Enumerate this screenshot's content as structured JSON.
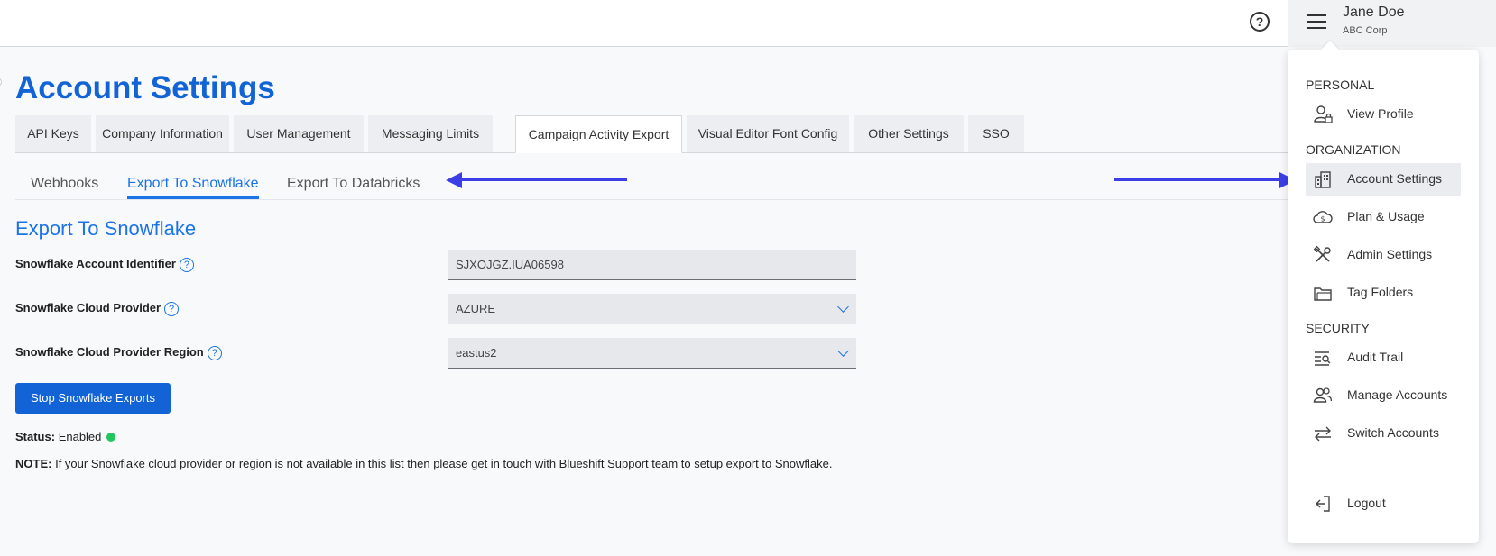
{
  "header": {
    "help_icon_text": "?",
    "user_name": "Jane Doe",
    "user_company": "ABC Corp"
  },
  "page": {
    "title": "Account Settings"
  },
  "main_tabs": [
    {
      "label": "API Keys"
    },
    {
      "label": "Company Information"
    },
    {
      "label": "User Management"
    },
    {
      "label": "Messaging Limits"
    },
    {
      "label": "Campaign Activity Export",
      "active": true
    },
    {
      "label": "Visual Editor Font Config"
    },
    {
      "label": "Other Settings"
    },
    {
      "label": "SSO"
    }
  ],
  "sub_tabs": [
    {
      "label": "Webhooks"
    },
    {
      "label": "Export To Snowflake",
      "active": true
    },
    {
      "label": "Export To Databricks"
    }
  ],
  "section": {
    "title": "Export To Snowflake",
    "fields": [
      {
        "label": "Snowflake Account Identifier",
        "value": "SJXOJGZ.IUA06598",
        "type": "text"
      },
      {
        "label": "Snowflake Cloud Provider",
        "value": "AZURE",
        "type": "select"
      },
      {
        "label": "Snowflake Cloud Provider Region",
        "value": "eastus2",
        "type": "select"
      }
    ],
    "help_icon_text": "?",
    "stop_button": "Stop Snowflake Exports",
    "status_label": "Status:",
    "status_value": "Enabled",
    "status_color": "#22c55e",
    "note_label": "NOTE:",
    "note_text": "If your Snowflake cloud provider or region is not available in this list then please get in touch with Blueshift Support team to setup export to Snowflake."
  },
  "menu": {
    "personal_label": "PERSONAL",
    "organization_label": "ORGANIZATION",
    "security_label": "SECURITY",
    "personal_items": [
      {
        "label": "View Profile",
        "icon": "user-lock-icon"
      }
    ],
    "organization_items": [
      {
        "label": "Account Settings",
        "icon": "building-icon",
        "active": true
      },
      {
        "label": "Plan & Usage",
        "icon": "cloud-dollar-icon"
      },
      {
        "label": "Admin Settings",
        "icon": "tools-icon"
      },
      {
        "label": "Tag Folders",
        "icon": "folders-icon"
      }
    ],
    "security_items": [
      {
        "label": "Audit Trail",
        "icon": "list-search-icon"
      },
      {
        "label": "Manage Accounts",
        "icon": "users-icon"
      },
      {
        "label": "Switch Accounts",
        "icon": "swap-arrows-icon"
      }
    ],
    "logout_label": "Logout"
  },
  "colors": {
    "primary": "#1264d6",
    "link": "#1b73e8",
    "arrow": "#3c3fe6"
  }
}
